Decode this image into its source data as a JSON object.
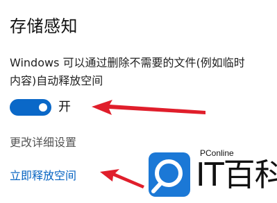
{
  "header": {
    "title": "存储感知"
  },
  "description": {
    "line1": "Windows 可以通过删除不需要的文件(例如临时",
    "line2": "内容)自动释放空间"
  },
  "toggle": {
    "state": "on",
    "label": "开",
    "accent": "#0a68c8"
  },
  "links": {
    "change_settings": "更改详细设置",
    "free_now": "立即释放空间",
    "link_color": "#0563c1"
  },
  "annotations": {
    "arrow_color": "#e01e2b"
  },
  "watermark": {
    "source": "PConline",
    "brand": "IT百科"
  }
}
